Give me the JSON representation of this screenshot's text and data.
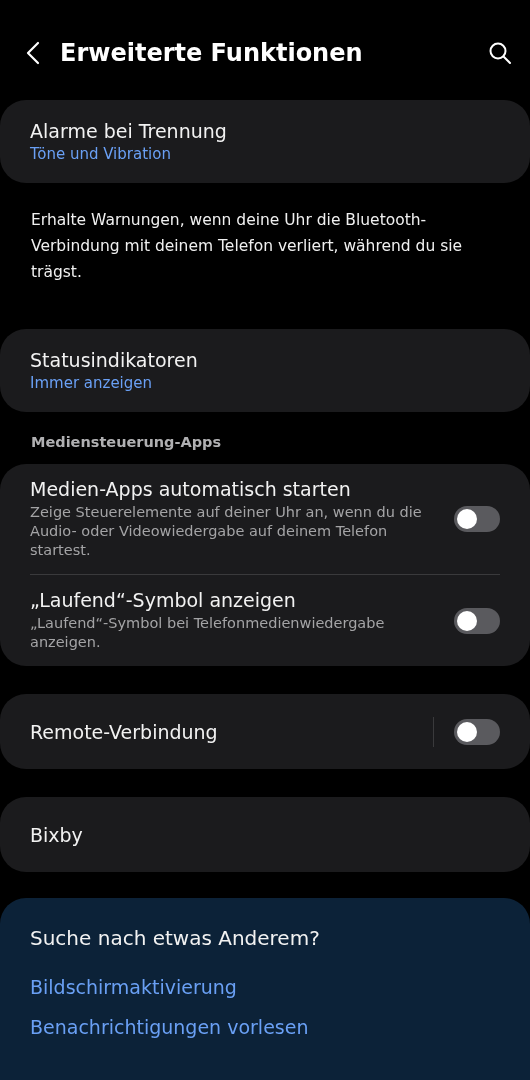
{
  "header": {
    "title": "Erweiterte Funktionen"
  },
  "sections": [
    {
      "kind": "card",
      "items": [
        {
          "kind": "link",
          "title": "Alarme bei Trennung",
          "subtitle": "Töne und Vibration"
        }
      ]
    },
    {
      "kind": "text",
      "text": "Erhalte Warnungen, wenn deine Uhr die Bluetooth-Verbindung mit deinem Telefon verliert, während du sie trägst."
    },
    {
      "kind": "card",
      "items": [
        {
          "kind": "link",
          "title": "Statusindikatoren",
          "subtitle": "Immer anzeigen"
        }
      ]
    },
    {
      "kind": "heading",
      "text": "Mediensteuerung-Apps"
    },
    {
      "kind": "card",
      "items": [
        {
          "kind": "toggle",
          "title": "Medien-Apps automatisch starten",
          "description": "Zeige Steuerelemente auf deiner Uhr an, wenn du die Audio- oder Videowiedergabe auf deinem Telefon startest.",
          "on": false
        },
        {
          "kind": "toggle",
          "title": "„Laufend“-Symbol anzeigen",
          "description": "„Laufend“-Symbol bei Telefonmedienwiedergabe anzeigen.",
          "on": false
        }
      ]
    },
    {
      "kind": "card",
      "items": [
        {
          "kind": "split-toggle",
          "title": "Remote-Verbindung",
          "on": false
        }
      ]
    },
    {
      "kind": "card",
      "items": [
        {
          "kind": "plain",
          "title": "Bixby"
        }
      ]
    }
  ],
  "suggestions": {
    "title": "Suche nach etwas Anderem?",
    "links": [
      "Bildschirmaktivierung",
      "Benachrichtigungen vorlesen"
    ]
  }
}
